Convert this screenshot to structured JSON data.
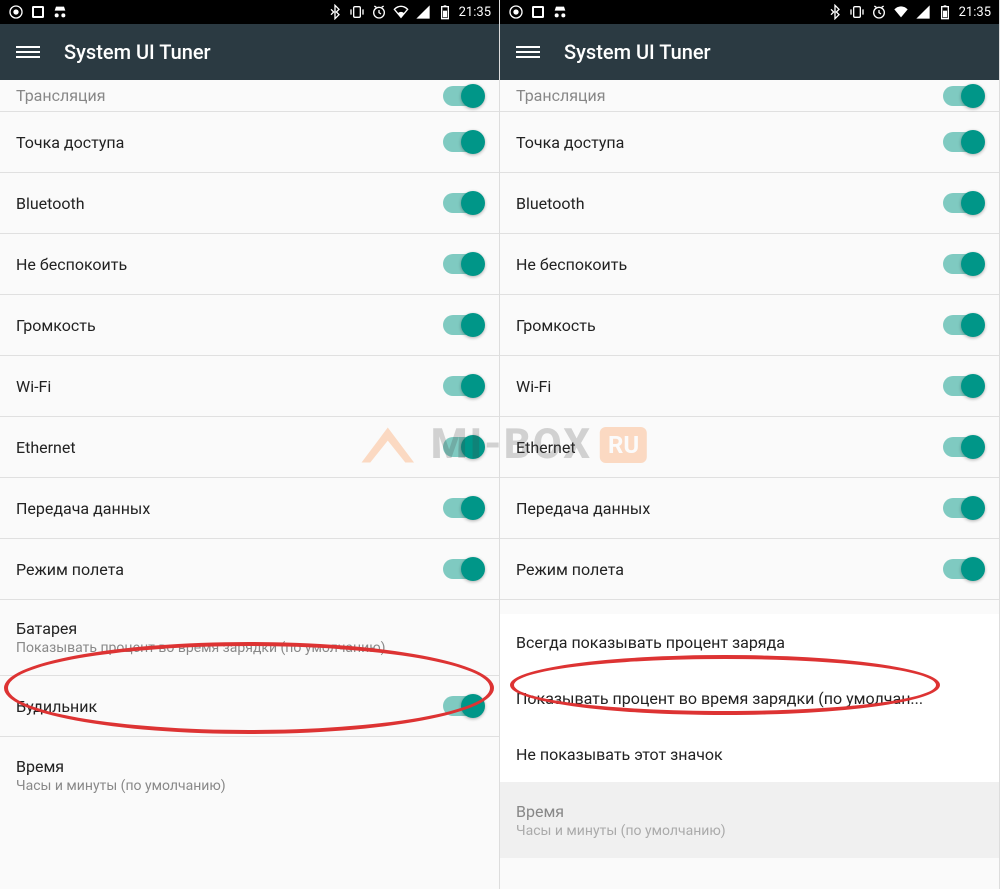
{
  "status": {
    "time": "21:35",
    "icons_left": [
      "app1",
      "app2",
      "incognito"
    ],
    "icons_right": [
      "bluetooth",
      "vibrate",
      "alarm",
      "wifi",
      "signal",
      "battery"
    ]
  },
  "appbar": {
    "title": "System UI Tuner"
  },
  "left_screen": {
    "items": [
      {
        "label": "Трансляция",
        "toggle": true,
        "partial": true
      },
      {
        "label": "Точка доступа",
        "toggle": true
      },
      {
        "label": "Bluetooth",
        "toggle": true
      },
      {
        "label": "Не беспокоить",
        "toggle": true
      },
      {
        "label": "Громкость",
        "toggle": true
      },
      {
        "label": "Wi-Fi",
        "toggle": true
      },
      {
        "label": "Ethernet",
        "toggle": true
      },
      {
        "label": "Передача данных",
        "toggle": true
      },
      {
        "label": "Режим полета",
        "toggle": true
      },
      {
        "label": "Батарея",
        "sublabel": "Показывать процент во время зарядки (по умолчанию)"
      },
      {
        "label": "Будильник",
        "toggle": true
      },
      {
        "label": "Время",
        "sublabel": "Часы и минуты (по умолчанию)"
      }
    ]
  },
  "right_screen": {
    "items": [
      {
        "label": "Трансляция",
        "toggle": true,
        "partial": true
      },
      {
        "label": "Точка доступа",
        "toggle": true
      },
      {
        "label": "Bluetooth",
        "toggle": true
      },
      {
        "label": "Не беспокоить",
        "toggle": true
      },
      {
        "label": "Громкость",
        "toggle": true
      },
      {
        "label": "Wi-Fi",
        "toggle": true
      },
      {
        "label": "Ethernet",
        "toggle": true
      },
      {
        "label": "Передача данных",
        "toggle": true
      },
      {
        "label": "Режим полета",
        "toggle": true
      }
    ],
    "options": [
      "Всегда показывать процент заряда",
      "Показывать процент во время зарядки (по умолчан...",
      "Не показывать этот значок"
    ],
    "dimmed": {
      "label": "Время",
      "sublabel": "Часы и минуты (по умолчанию)"
    }
  },
  "watermark": {
    "text": "MI-BOX",
    "suffix": "RU"
  }
}
